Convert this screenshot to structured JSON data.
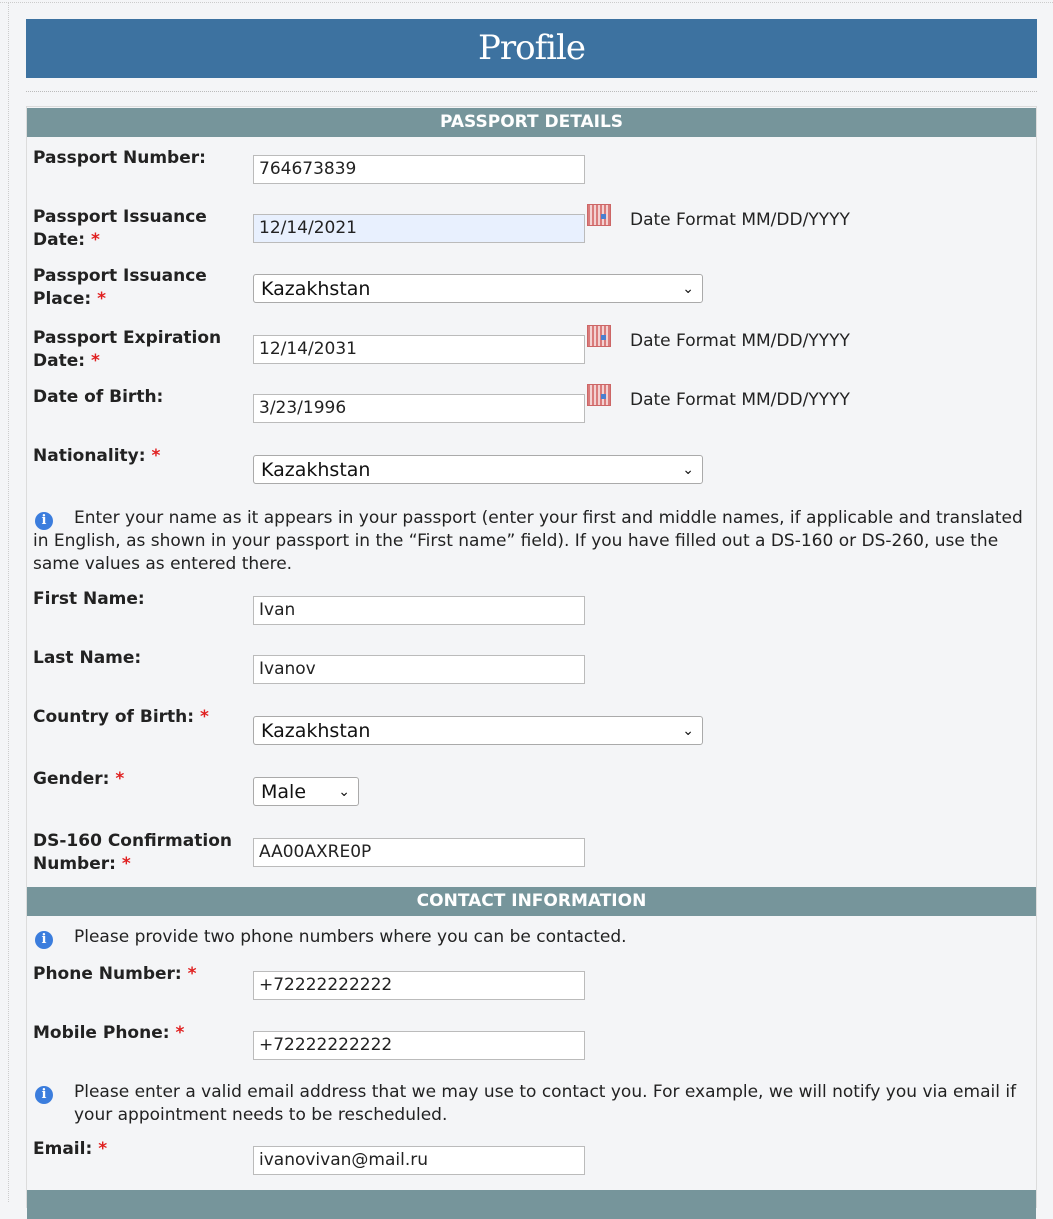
{
  "header": {
    "title": "Profile"
  },
  "sections": {
    "passport": "PASSPORT DETAILS",
    "contact": "CONTACT INFORMATION"
  },
  "date_format": "Date Format MM/DD/YYYY",
  "required_mark": "*",
  "fields": {
    "passport_number": {
      "label": "Passport Number:",
      "value": "764673839"
    },
    "issuance_date": {
      "label": "Passport Issuance Date:",
      "value": "12/14/2021"
    },
    "issuance_place": {
      "label": "Passport Issuance Place:",
      "value": "Kazakhstan"
    },
    "expiration_date": {
      "label": "Passport Expiration Date:",
      "value": "12/14/2031"
    },
    "dob": {
      "label": "Date of Birth:",
      "value": "3/23/1996"
    },
    "nationality": {
      "label": "Nationality:",
      "value": "Kazakhstan"
    },
    "first_name": {
      "label": "First Name:",
      "value": "Ivan"
    },
    "last_name": {
      "label": "Last Name:",
      "value": "Ivanov"
    },
    "country_of_birth": {
      "label": "Country of Birth:",
      "value": "Kazakhstan"
    },
    "gender": {
      "label": "Gender:",
      "value": "Male"
    },
    "ds160": {
      "label": "DS-160 Confirmation Number:",
      "value": "AA00AXRE0P"
    },
    "phone": {
      "label": "Phone Number:",
      "value": "+72222222222"
    },
    "mobile": {
      "label": "Mobile Phone:",
      "value": "+72222222222"
    },
    "email": {
      "label": "Email:",
      "value": "ivanovivan@mail.ru"
    }
  },
  "info": {
    "name": "Enter your name as it appears in your passport (enter your first and middle names, if applicable and translated in English, as shown in your passport in the “First name” field). If you have filled out a DS-160 or DS-260, use the same values as entered there.",
    "phone": "Please provide two phone numbers where you can be contacted.",
    "email": "Please enter a valid email address that we may use to contact you. For example, we will notify you via email if your appointment needs to be rescheduled."
  },
  "colors": {
    "header": "#3d72a0",
    "section": "#76959b",
    "required": "#e02020",
    "info_icon": "#3b7ddd"
  }
}
